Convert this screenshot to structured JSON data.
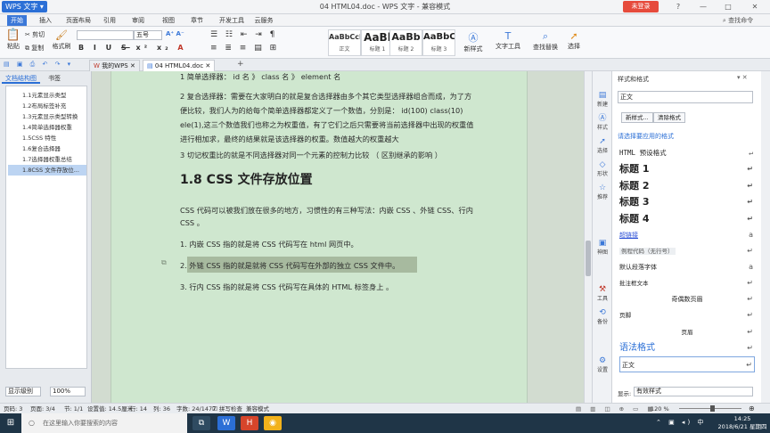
{
  "titlebar": {
    "app_name": "WPS 文字",
    "title": "04 HTML04.doc - WPS 文字 - 兼容模式",
    "login_label": "未登录",
    "controls": [
      "?",
      "—",
      "□",
      "✕"
    ]
  },
  "menu": {
    "items": [
      "开始",
      "插入",
      "页面布局",
      "引用",
      "审阅",
      "视图",
      "章节",
      "开发工具",
      "云服务"
    ],
    "active": "开始",
    "search_label": "查找命令"
  },
  "ribbon": {
    "paste": "粘贴",
    "cut": "剪切",
    "copy": "复制",
    "format_painter": "格式刷",
    "font_name": "",
    "font_size": "五号",
    "styles": [
      {
        "preview": "AaBbCcDd",
        "caption": "正文"
      },
      {
        "preview": "AaBl",
        "caption": "标题 1"
      },
      {
        "preview": "AaBb",
        "caption": "标题 2"
      },
      {
        "preview": "AaBbC",
        "caption": "标题 3"
      }
    ],
    "new_style": "新样式",
    "text_tools": "文字工具",
    "find_replace": "查找替换",
    "select": "选择"
  },
  "tabs": {
    "items": [
      "我的WPS",
      "04 HTML04.doc"
    ],
    "active": "04 HTML04.doc",
    "add": "+"
  },
  "nav": {
    "tabs": [
      "文档结构图",
      "书签"
    ],
    "items": [
      "1.1元素显示类型",
      "1.2布局标签补充",
      "1.3元素显示类型转换",
      "1.4简单选择器权重",
      "1.5CSS 特性",
      "1.6复合选择器",
      "1.7选择器权重总结",
      "1.8CSS 文件存放位..."
    ],
    "selected_index": 7,
    "level_label": "显示级别",
    "zoom_label": "100%"
  },
  "document": {
    "line1": "1 简单选择器：  id 名 》  class 名 》  element 名",
    "para2_l1": "2 复合选择器：需要在大家明白的就是复合选择器由多个其它类型选择器组合而成，为了方",
    "para2_l2": "便比较，我们人为的给每个简单选择器都定义了一个数值，分别是：    id(100)    class(10)",
    "para2_l3": "ele(1),这三个数值我们也称之为权重值，有了它们之后只需要将当前选择器中出现的权重值",
    "para2_l4": "进行相加求，最终的结果就是该选择器的权重。数值越大的权重越大",
    "line3": "3  切记权重比的就是不同选择器对同一个元素的控制力比较  （  区别继承的影响  ）",
    "heading": "1.8 CSS 文件存放位置",
    "intro_l1": "CSS 代码可以被我们放在很多的地方，习惯性的有三种写法：内嵌 CSS 、外链 CSS、行内",
    "intro_l2": "CSS 。",
    "item1": "1.  内嵌 CSS 指的就是将   CSS  代码写在  html  网页中。",
    "item2": "2.  外链 CSS 指的就是就将  CSS 代码写在外部的独立  CSS  文件中。",
    "item3": "3.  行内 CSS 指的就是将   CSS  代码写在具体的  HTML  标签身上  。"
  },
  "rightstrip": [
    "新建",
    "样式",
    "选择",
    "形状",
    "推荐",
    "神图",
    "工具",
    "备份",
    "设置"
  ],
  "stylepane": {
    "title": "样式和格式",
    "current": "正文",
    "new_btn": "新样式...",
    "clear_btn": "清除格式",
    "hint": "请选择要应用的格式",
    "items": [
      {
        "label": "HTML 预设格式",
        "kind": "mono"
      },
      {
        "label": "标题 1",
        "kind": "h"
      },
      {
        "label": "标题 2",
        "kind": "h"
      },
      {
        "label": "标题 3",
        "kind": "h"
      },
      {
        "label": "标题 4",
        "kind": "h"
      },
      {
        "label": "超链接",
        "kind": "link"
      },
      {
        "label": "例程代码（无行号）",
        "kind": "code"
      },
      {
        "label": "默认段落字体",
        "kind": "small"
      },
      {
        "label": "批注框文本",
        "kind": "tiny"
      },
      {
        "label": "奇偶数页眉",
        "kind": "center"
      },
      {
        "label": "页脚",
        "kind": "tiny"
      },
      {
        "label": "页眉",
        "kind": "center"
      }
    ],
    "syntax_label": "语法格式",
    "syntax_value": "正文",
    "show_label": "显示:",
    "show_value": "有效样式"
  },
  "status": {
    "page_no": "页码: 3",
    "pages": "页面: 3/4",
    "section": "节: 1/1",
    "position": "设置值: 14.5厘米",
    "row": "行: 14",
    "col": "列: 36",
    "words": "字数: 24/1477",
    "spell": "拼写检查",
    "compat": "兼容模式",
    "zoom": "120 %"
  },
  "taskbar": {
    "search_placeholder": "在这里输入你要搜索的内容",
    "time": "14:25",
    "date": "2018/6/21 星期四"
  }
}
